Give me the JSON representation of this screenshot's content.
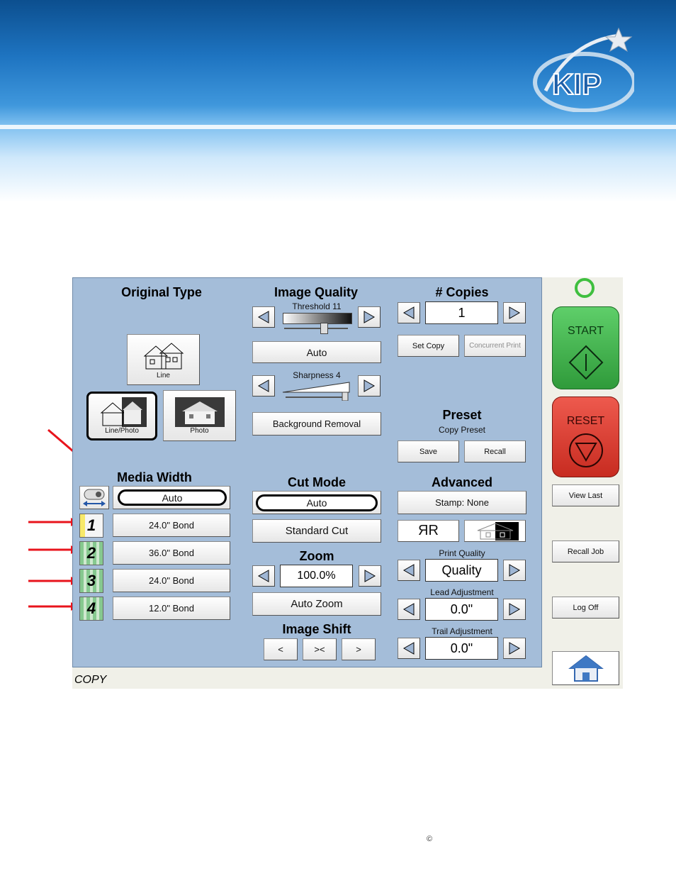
{
  "original_type": {
    "title": "Original Type",
    "line": "Line",
    "line_photo": "Line/Photo",
    "photo": "Photo"
  },
  "image_quality": {
    "title": "Image Quality",
    "threshold_label": "Threshold 11",
    "auto": "Auto",
    "sharpness_label": "Sharpness 4",
    "background_removal": "Background Removal"
  },
  "copies": {
    "title": "# Copies",
    "value": "1",
    "set_copy": "Set Copy",
    "concurrent_print": "Concurrent Print"
  },
  "preset": {
    "title": "Preset",
    "subtitle": "Copy Preset",
    "save": "Save",
    "recall": "Recall"
  },
  "media_width": {
    "title": "Media Width",
    "value": "Auto",
    "rolls": [
      {
        "num": "1",
        "label": "24.0\" Bond"
      },
      {
        "num": "2",
        "label": "36.0\" Bond"
      },
      {
        "num": "3",
        "label": "24.0\" Bond"
      },
      {
        "num": "4",
        "label": "12.0\" Bond"
      }
    ]
  },
  "cut_mode": {
    "title": "Cut Mode",
    "value": "Auto",
    "standard_cut": "Standard Cut"
  },
  "zoom": {
    "title": "Zoom",
    "value": "100.0%",
    "auto_zoom": "Auto Zoom"
  },
  "image_shift": {
    "title": "Image Shift",
    "left": "<",
    "center": "><",
    "right": ">"
  },
  "advanced": {
    "title": "Advanced",
    "stamp": "Stamp: None",
    "mirror": "ЯR",
    "print_quality_label": "Print Quality",
    "print_quality_value": "Quality",
    "lead_label": "Lead Adjustment",
    "lead_value": "0.0\"",
    "trail_label": "Trail Adjustment",
    "trail_value": "0.0\""
  },
  "side": {
    "start": "START",
    "reset": "RESET",
    "view_last": "View Last",
    "recall_job": "Recall Job",
    "log_off": "Log Off"
  },
  "status": {
    "mode": "COPY"
  },
  "logo": {
    "text": "KIP"
  },
  "footer": {
    "copyright": "©"
  },
  "colors": {
    "panel": "#a4bdd9",
    "start": "#3aa24a",
    "reset": "#d8382c",
    "tray_green": "#86c98f",
    "annotation_red": "#e8141c"
  }
}
